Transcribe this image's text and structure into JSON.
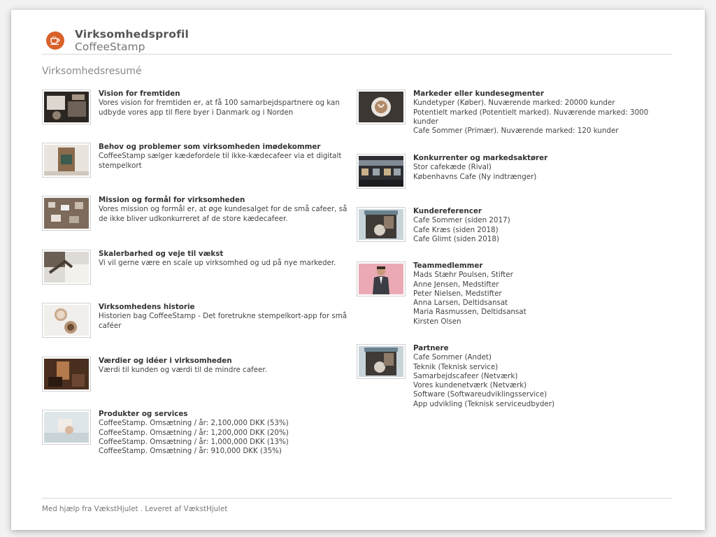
{
  "header": {
    "title": "Virksomhedsprofil",
    "subtitle": "CoffeeStamp",
    "logo_icon": "coffee-cup-icon",
    "accent_color": "#d9622a"
  },
  "section_title": "Virksomhedsresumé",
  "left_items": [
    {
      "title": "Vision for fremtiden",
      "lines": [
        "Vores vision for fremtiden er, at få 100 samarbejdspartnere og kan",
        "udbyde vores app til flere byer i Danmark og i Norden"
      ]
    },
    {
      "title": "Behov og problemer som virksomheden imødekommer",
      "lines": [
        "CoffeeStamp sælger kædefordele til ikke-kædecafeer via et digitalt",
        "stempelkort"
      ]
    },
    {
      "title": "Mission og formål for virksomheden",
      "lines": [
        "Vores mission og formål er, at øge kundesalget for de små cafeer, så",
        "de ikke bliver udkonkurreret af de store kædecafeer."
      ]
    },
    {
      "title": "Skalerbarhed og veje til vækst",
      "lines": [
        "Vi vil gerne være en scale up virksomhed og ud på nye markeder."
      ]
    },
    {
      "title": "Virksomhedens historie",
      "lines": [
        "Historien bag CoffeeStamp - Det foretrukne stempelkort-app for små",
        "caféer"
      ]
    },
    {
      "title": "Værdier og idéer i virksomheden",
      "lines": [
        "Værdi til kunden og værdi til de mindre cafeer."
      ]
    },
    {
      "title": "Produkter og services",
      "lines": [
        "CoffeeStamp. Omsætning / år: 2,100,000 DKK (53%)",
        "CoffeeStamp. Omsætning / år: 1,200,000 DKK (20%)",
        "CoffeeStamp. Omsætning / år: 1,000,000 DKK (13%)",
        "CoffeeStamp. Omsætning / år: 910,000 DKK (35%)"
      ]
    }
  ],
  "right_items": [
    {
      "title": "Markeder eller kundesegmenter",
      "lines": [
        "Kundetyper (Køber). Nuværende marked: 20000 kunder",
        "Potentielt marked (Potentielt marked). Nuværende marked: 3000",
        "kunder",
        "Cafe Sommer (Primær). Nuværende marked: 120 kunder"
      ]
    },
    {
      "title": "Konkurrenter og markedsaktører",
      "lines": [
        "Stor cafekæde (Rival)",
        "Københavns Cafe (Ny indtrænger)"
      ]
    },
    {
      "title": "Kundereferencer",
      "lines": [
        "Cafe Sommer (siden 2017)",
        "Cafe Kræs (siden 2018)",
        "Cafe Glimt (siden 2018)"
      ]
    },
    {
      "title": "Teammedlemmer",
      "lines": [
        "Mads Stæhr Poulsen, Stifter",
        "Anne Jensen, Medstifter",
        "Peter Nielsen, Medstifter",
        "Anna Larsen, Deltidsansat",
        "Maria Rasmussen, Deltidsansat",
        "Kirsten Olsen"
      ]
    },
    {
      "title": "Partnere",
      "lines": [
        "Cafe Sommer (Andet)",
        "Teknik (Teknisk service)",
        "Samarbejdscafeer (Netværk)",
        "Vores kundenetværk (Netværk)",
        "Software (Softwareudviklingsservice)",
        "App udvikling (Teknisk serviceudbyder)"
      ]
    }
  ],
  "footer": {
    "text": "Med hjælp fra VækstHjulet . Leveret af VækstHjulet"
  }
}
